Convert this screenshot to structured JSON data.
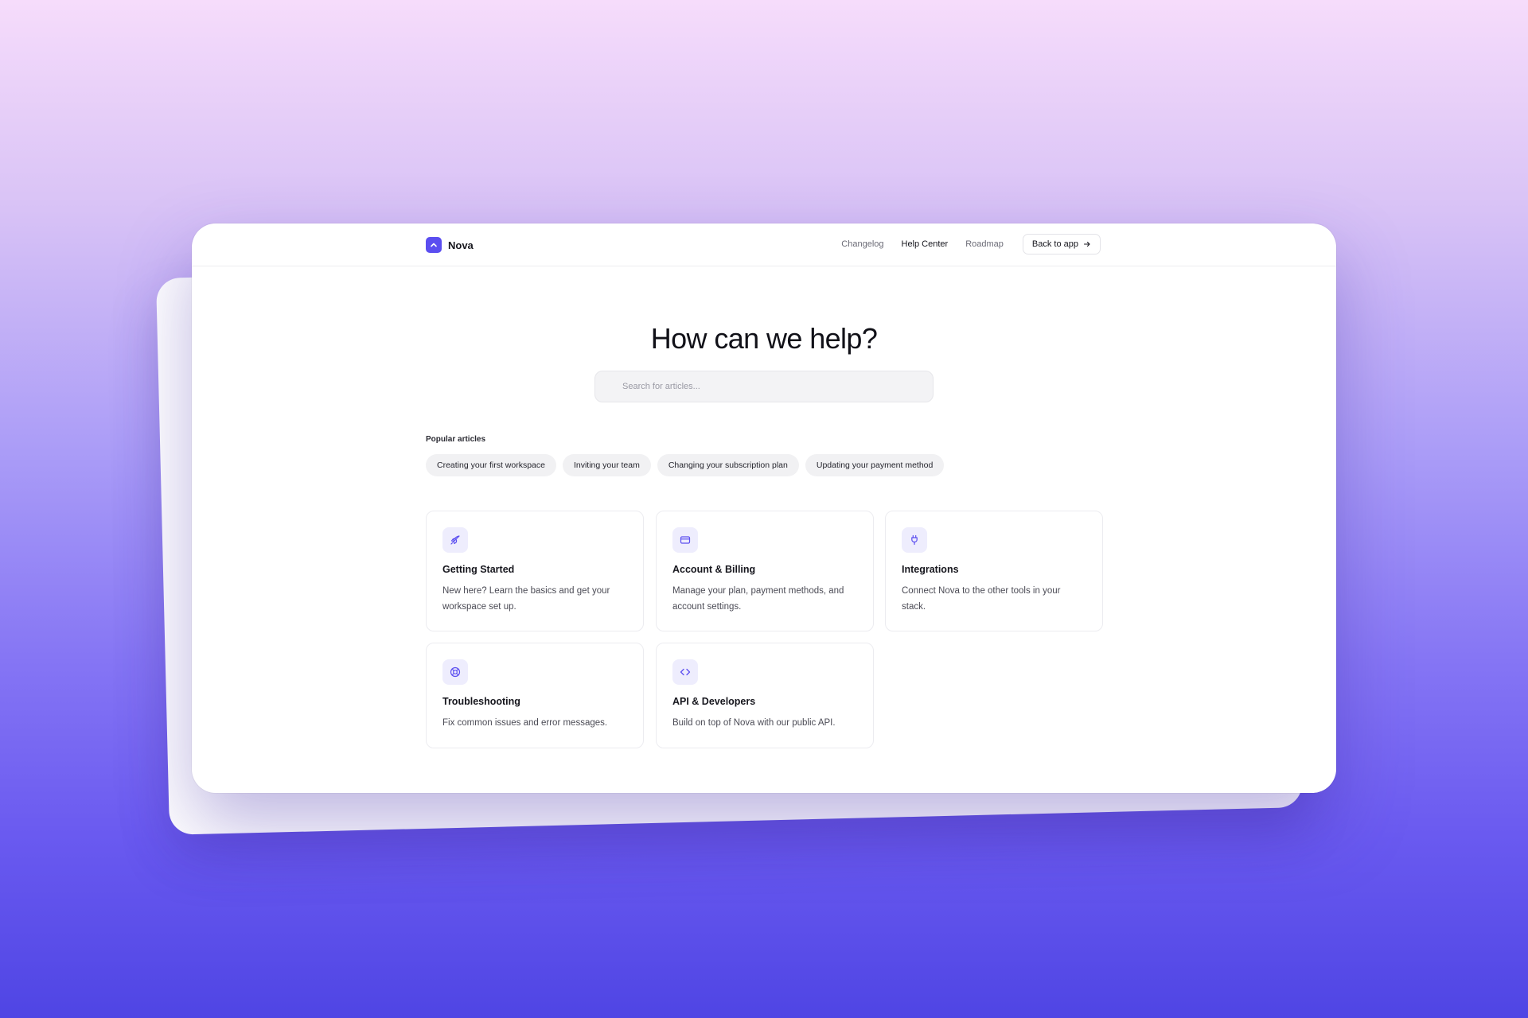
{
  "brand": {
    "name": "Nova",
    "logo_icon": "chevron-up-icon",
    "accent": "#5b4ef0"
  },
  "nav": {
    "links": [
      "Changelog",
      "Help Center",
      "Roadmap"
    ],
    "active": "Help Center",
    "back_button": "Back to app",
    "back_icon": "arrow-right-icon"
  },
  "hero": {
    "title": "How can we help?",
    "search_placeholder": "Search for articles..."
  },
  "popular": {
    "label": "Popular articles",
    "articles": [
      "Creating your first workspace",
      "Inviting your team",
      "Changing your subscription plan",
      "Updating your payment method"
    ]
  },
  "categories": [
    {
      "title": "Getting Started",
      "description": "New here? Learn the basics and get your workspace set up.",
      "icon": "rocket-icon"
    },
    {
      "title": "Account & Billing",
      "description": "Manage your plan, payment methods, and account settings.",
      "icon": "credit-card-icon"
    },
    {
      "title": "Integrations",
      "description": "Connect Nova to the other tools in your stack.",
      "icon": "plug-icon"
    },
    {
      "title": "Troubleshooting",
      "description": "Fix common issues and error messages.",
      "icon": "life-buoy-icon"
    },
    {
      "title": "API & Developers",
      "description": "Build on top of Nova with our public API.",
      "icon": "code-icon"
    }
  ]
}
